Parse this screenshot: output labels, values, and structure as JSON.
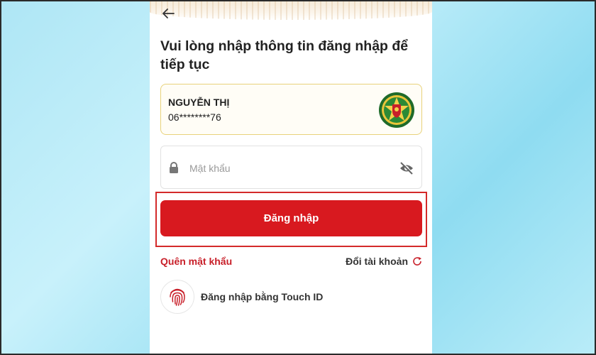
{
  "header": {
    "back_icon": "arrow-left-icon"
  },
  "title": "Vui lòng nhập thông tin đăng nhập để tiếp tục",
  "user": {
    "name": "NGUYỄN THỊ",
    "phone": "06********76",
    "emblem_icon": "police-emblem-icon"
  },
  "password": {
    "placeholder": "Mật khẩu",
    "value": "",
    "lock_icon": "lock-icon",
    "toggle_icon": "eye-off-icon"
  },
  "actions": {
    "login_label": "Đăng nhập",
    "forgot_label": "Quên mật khẩu",
    "switch_label": "Đổi tài khoản",
    "switch_icon": "refresh-icon",
    "touch_label": "Đăng nhập bằng Touch ID",
    "touch_icon": "fingerprint-icon"
  },
  "colors": {
    "primary": "#d8191f",
    "highlight": "#d42a2a",
    "card_border": "#e8d27a"
  }
}
